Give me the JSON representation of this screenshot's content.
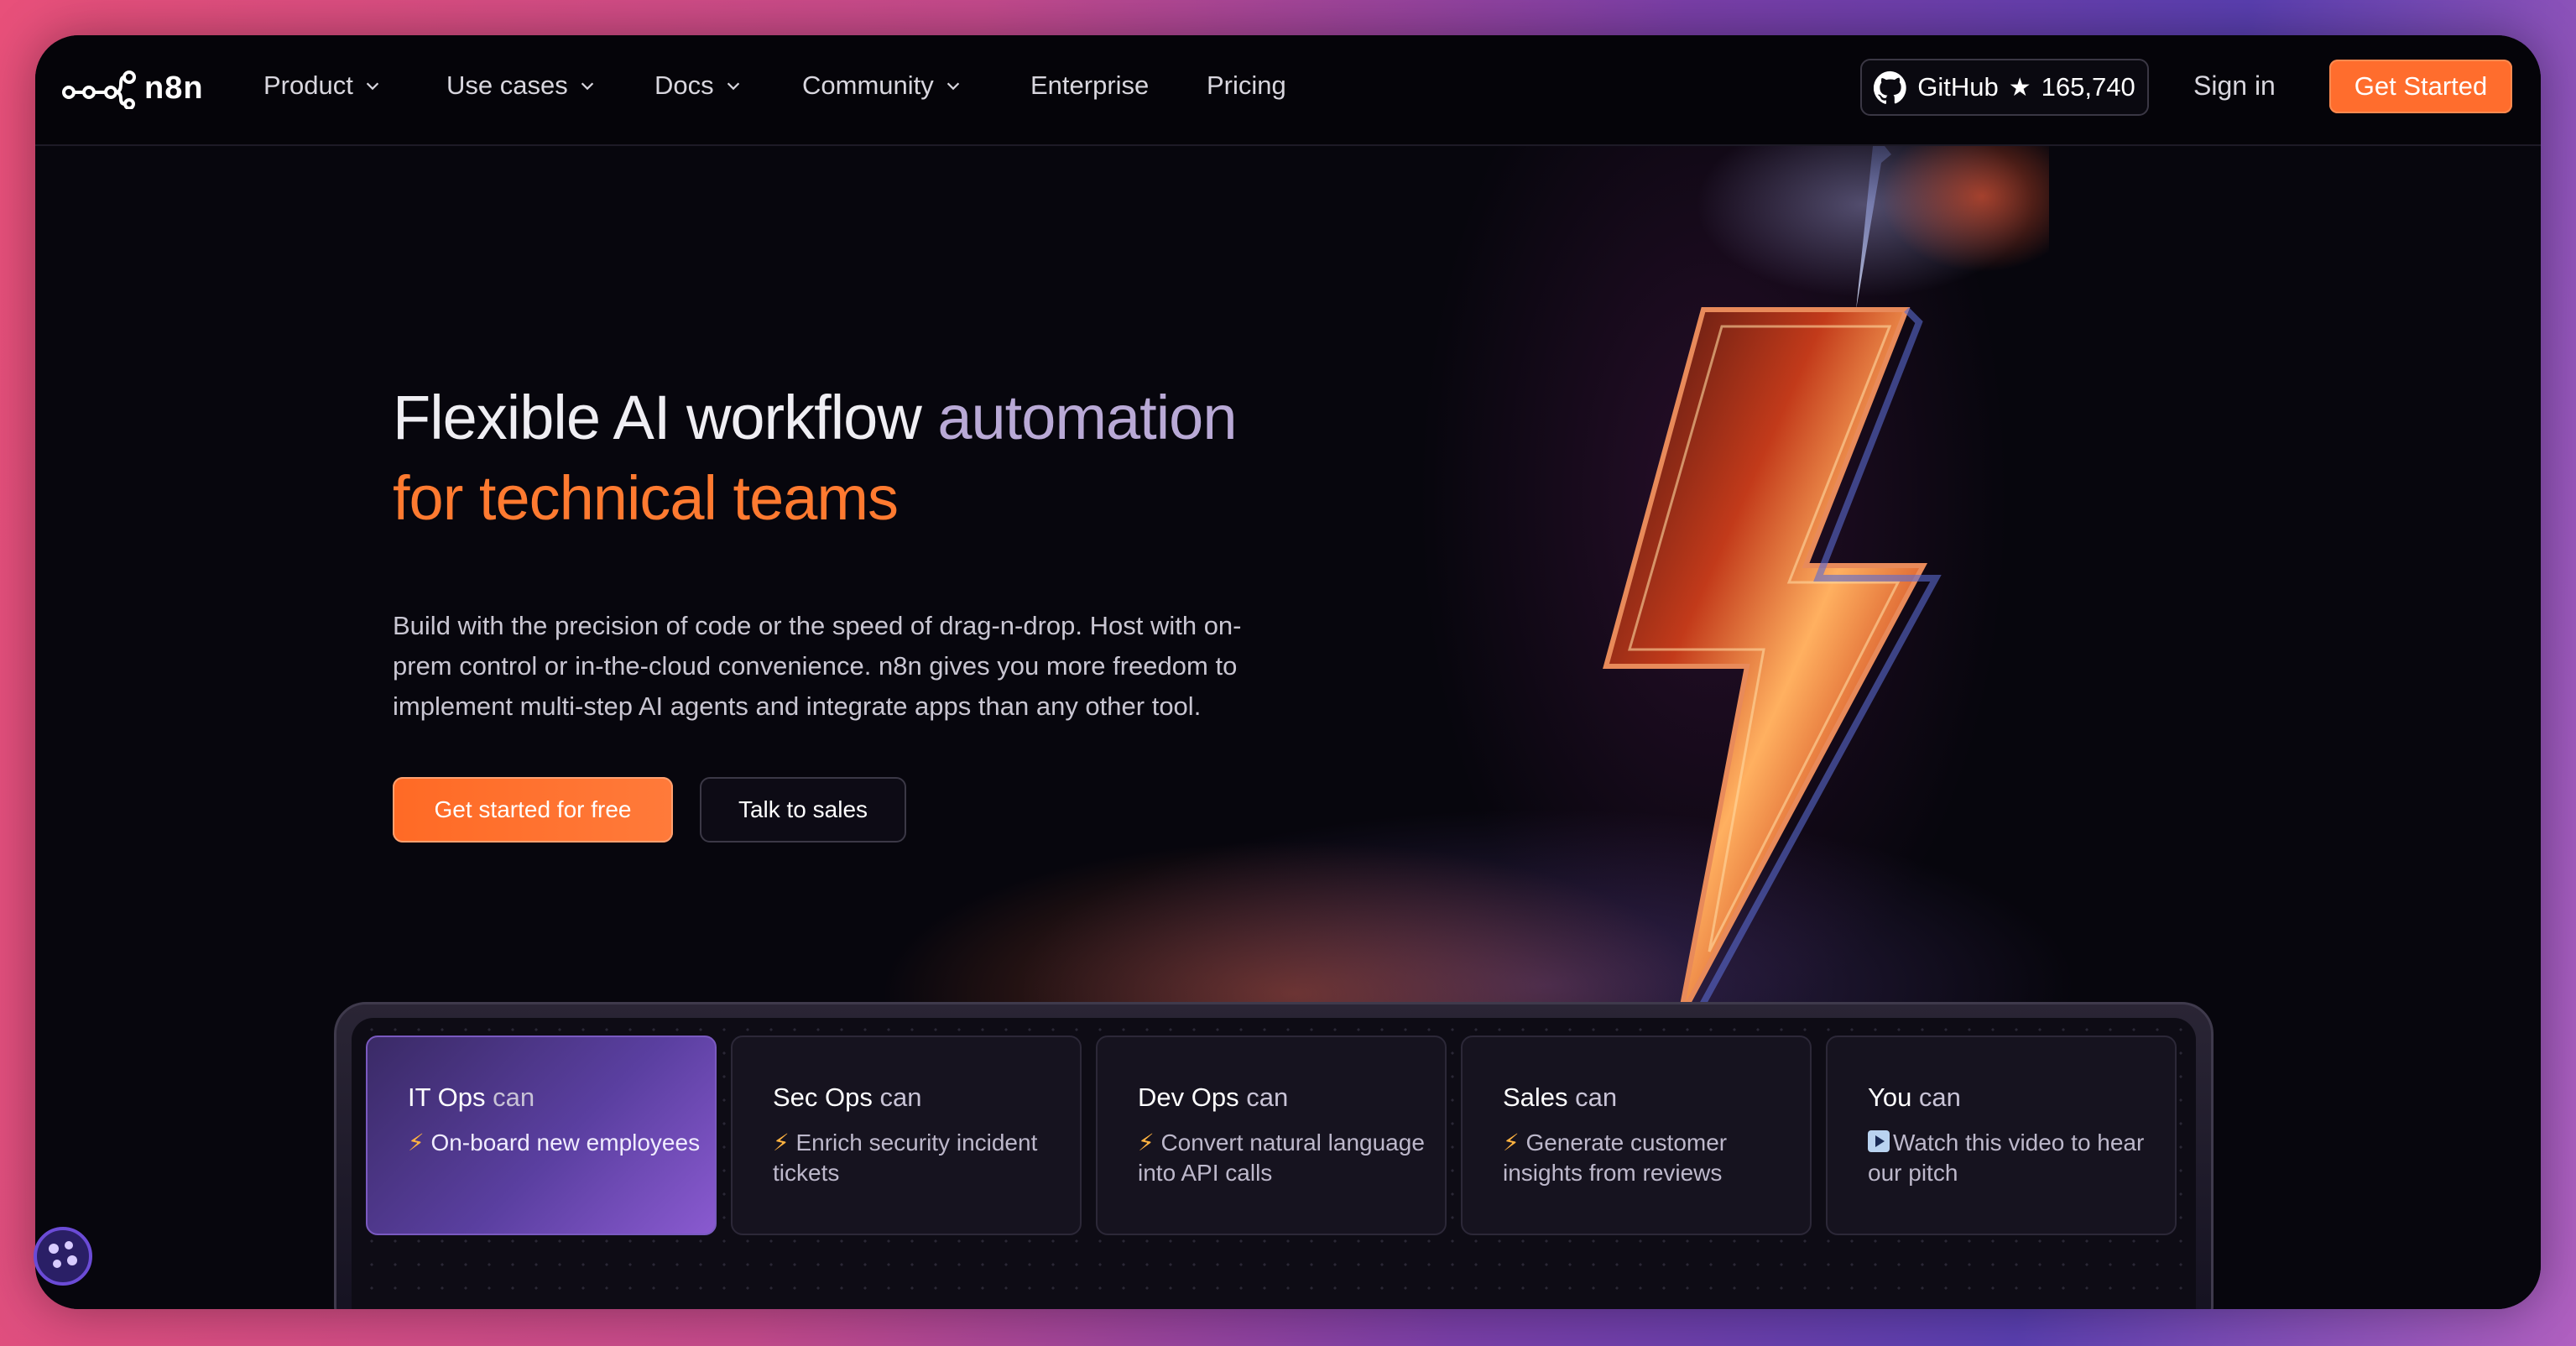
{
  "nav": {
    "logo_text": "n8n",
    "items": [
      {
        "label": "Product",
        "has_dropdown": true
      },
      {
        "label": "Use cases",
        "has_dropdown": true
      },
      {
        "label": "Docs",
        "has_dropdown": true
      },
      {
        "label": "Community",
        "has_dropdown": true
      },
      {
        "label": "Enterprise",
        "has_dropdown": false
      },
      {
        "label": "Pricing",
        "has_dropdown": false
      }
    ],
    "github_label": "GitHub",
    "github_stars": "165,740",
    "sign_in": "Sign in",
    "get_started": "Get Started",
    "accent": "#ff6d2d"
  },
  "hero": {
    "title_part1": "Flexible AI workflow ",
    "title_part2": "automation",
    "title_part3": "for technical teams",
    "description": "Build with the precision of code or the speed of drag-n-drop. Host with on-prem control or in-the-cloud convenience. n8n gives you more freedom to implement multi-step AI agents and integrate apps than any other tool.",
    "cta_primary": "Get started for free",
    "cta_secondary": "Talk to sales"
  },
  "cards": [
    {
      "role": "IT Ops",
      "can": " can",
      "icon": "bolt-icon",
      "desc": "On-board new employees",
      "active": true
    },
    {
      "role": "Sec Ops",
      "can": " can",
      "icon": "bolt-icon",
      "desc": "Enrich security incident tickets",
      "active": false
    },
    {
      "role": "Dev Ops",
      "can": " can",
      "icon": "bolt-icon",
      "desc": "Convert natural language into API calls",
      "active": false
    },
    {
      "role": "Sales",
      "can": " can",
      "icon": "bolt-icon",
      "desc": "Generate customer insights from reviews",
      "active": false
    },
    {
      "role": "You",
      "can": " can",
      "icon": "play-icon",
      "desc": "Watch this video to hear our pitch",
      "active": false
    }
  ]
}
